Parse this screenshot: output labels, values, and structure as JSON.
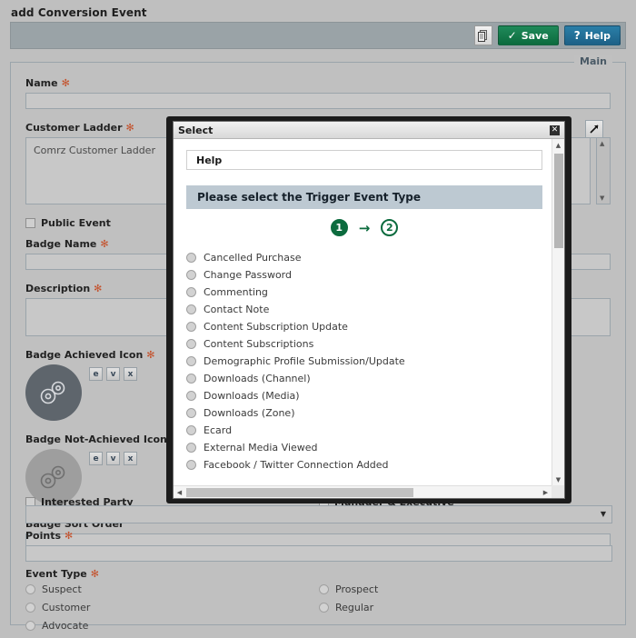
{
  "page": {
    "title": "add Conversion Event",
    "legend": "Main"
  },
  "toolbar": {
    "copy_icon": "copy-icon",
    "save_label": "Save",
    "save_glyph": "✓",
    "help_label": "Help",
    "help_glyph": "?",
    "save_color": "#0c6b3e",
    "help_color": "#1d6187"
  },
  "form": {
    "required_marker": "✻",
    "name": {
      "label": "Name",
      "value": "",
      "placeholder": ""
    },
    "customer_ladder": {
      "label": "Customer Ladder",
      "value": "Comrz Customer Ladder"
    },
    "public_event": {
      "label": "Public Event",
      "checked": false
    },
    "badge_name": {
      "label": "Badge Name",
      "value": ""
    },
    "description": {
      "label": "Description",
      "value": ""
    },
    "badge_achieved_icon": {
      "label": "Badge Achieved Icon",
      "icon": "gears-icon",
      "color": "#5e656c",
      "buttons": [
        "e",
        "v",
        "x"
      ]
    },
    "badge_not_achieved_icon": {
      "label": "Badge Not-Achieved Icon",
      "icon": "gears-icon",
      "color": "#9e9e9e",
      "buttons": [
        "e",
        "v",
        "x"
      ]
    },
    "badge_sort_order": {
      "label": "Badge Sort Order",
      "value": ""
    },
    "trigger_event_select": {
      "value": "",
      "caret": "▼"
    },
    "points": {
      "label": "Points",
      "value": ""
    },
    "event_type": {
      "label": "Event Type",
      "col1": [
        "Suspect",
        "Customer",
        "Advocate"
      ],
      "col2": [
        "Prospect",
        "Regular"
      ]
    },
    "obscured": {
      "left": "Interested Party",
      "right": "Manager & Executive"
    }
  },
  "modal": {
    "title": "Select",
    "close_glyph": "✕",
    "help_label": "Help",
    "prompt": "Please select the Trigger Event Type",
    "steps": {
      "current": "1",
      "next": "2",
      "arrow": "→"
    },
    "options": [
      "Cancelled Purchase",
      "Change Password",
      "Commenting",
      "Contact Note",
      "Content Subscription Update",
      "Content Subscriptions",
      "Demographic Profile Submission/Update",
      "Downloads (Channel)",
      "Downloads (Media)",
      "Downloads (Zone)",
      "Ecard",
      "External Media Viewed",
      "Facebook / Twitter Connection Added"
    ],
    "scroll": {
      "up_glyph": "▲",
      "down_glyph": "▼",
      "left_glyph": "◀",
      "right_glyph": "▶"
    }
  }
}
